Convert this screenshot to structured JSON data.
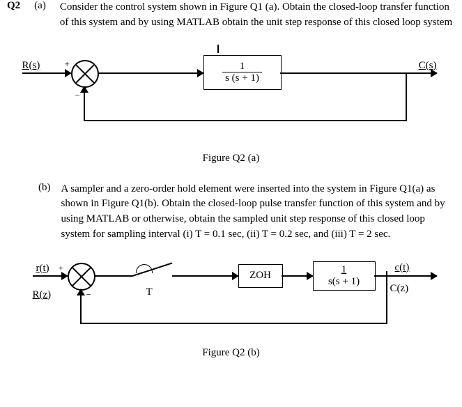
{
  "question_label": "Q2",
  "part_a": {
    "label": "(a)",
    "text": "Consider the control system shown in Figure Q1 (a). Obtain the closed-loop transfer function of this system and by using MATLAB obtain the unit step response of this closed loop system"
  },
  "figure_a": {
    "caption": "Figure Q2 (a)",
    "input_label": "R(s)",
    "output_label": "C(s)",
    "plus_sign": "+",
    "minus_sign": "−",
    "transfer_function": {
      "num": "1",
      "den": "s (s  + 1)"
    }
  },
  "part_b": {
    "label": "(b)",
    "text": "A sampler and a zero-order hold element were inserted into the system in Figure Q1(a) as shown in Figure Q1(b). Obtain the closed-loop pulse transfer function of this system and by using MATLAB or otherwise, obtain the sampled unit step response of this closed loop system for sampling interval (i) T = 0.1 sec, (ii) T = 0.2 sec, and (iii) T = 2 sec."
  },
  "figure_b": {
    "caption": "Figure Q2 (b)",
    "input_top": "r(t)",
    "input_bottom": "R(z)",
    "output_top": "c(t)",
    "output_bottom": "C(z)",
    "plus_sign": "+",
    "minus_sign": "−",
    "sampler_label": "T",
    "zoh_label": "ZOH",
    "transfer_function": {
      "num": "1",
      "den": "s(s + 1)"
    }
  }
}
